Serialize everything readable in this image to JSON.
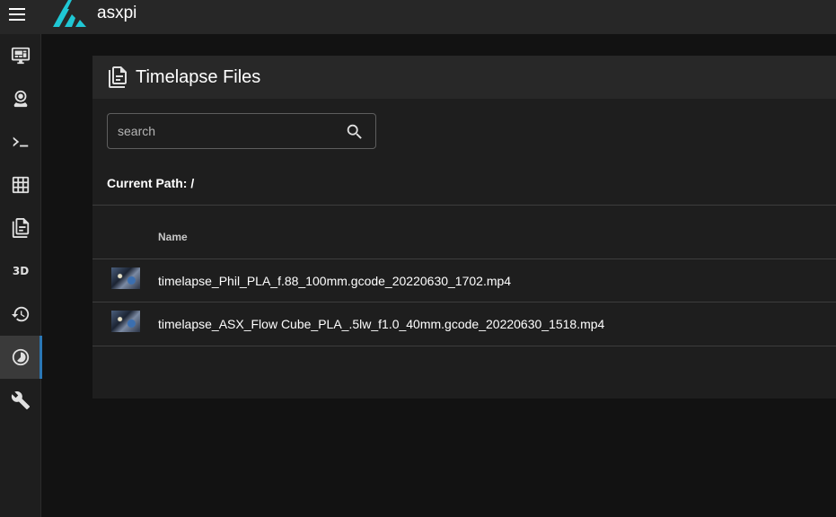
{
  "app": {
    "title": "asxpi"
  },
  "sidebar": {
    "items": [
      {
        "icon": "monitor-dashboard-icon"
      },
      {
        "icon": "webcam-icon"
      },
      {
        "icon": "console-icon"
      },
      {
        "icon": "grid-icon"
      },
      {
        "icon": "file-document-icon"
      },
      {
        "label": "3D"
      },
      {
        "icon": "history-icon"
      },
      {
        "icon": "timelapse-icon",
        "active": true
      },
      {
        "icon": "wrench-icon"
      }
    ]
  },
  "card": {
    "title": "Timelapse Files",
    "search_placeholder": "search",
    "current_path_label": "Current Path: /",
    "table": {
      "name_header": "Name",
      "rows": [
        {
          "name": "timelapse_Phil_PLA_f.88_100mm.gcode_20220630_1702.mp4"
        },
        {
          "name": "timelapse_ASX_Flow Cube_PLA_.5lw_f1.0_40mm.gcode_20220630_1518.mp4"
        }
      ]
    }
  },
  "colors": {
    "accent": "#2a77b5",
    "logo": "#1fc7d4"
  }
}
